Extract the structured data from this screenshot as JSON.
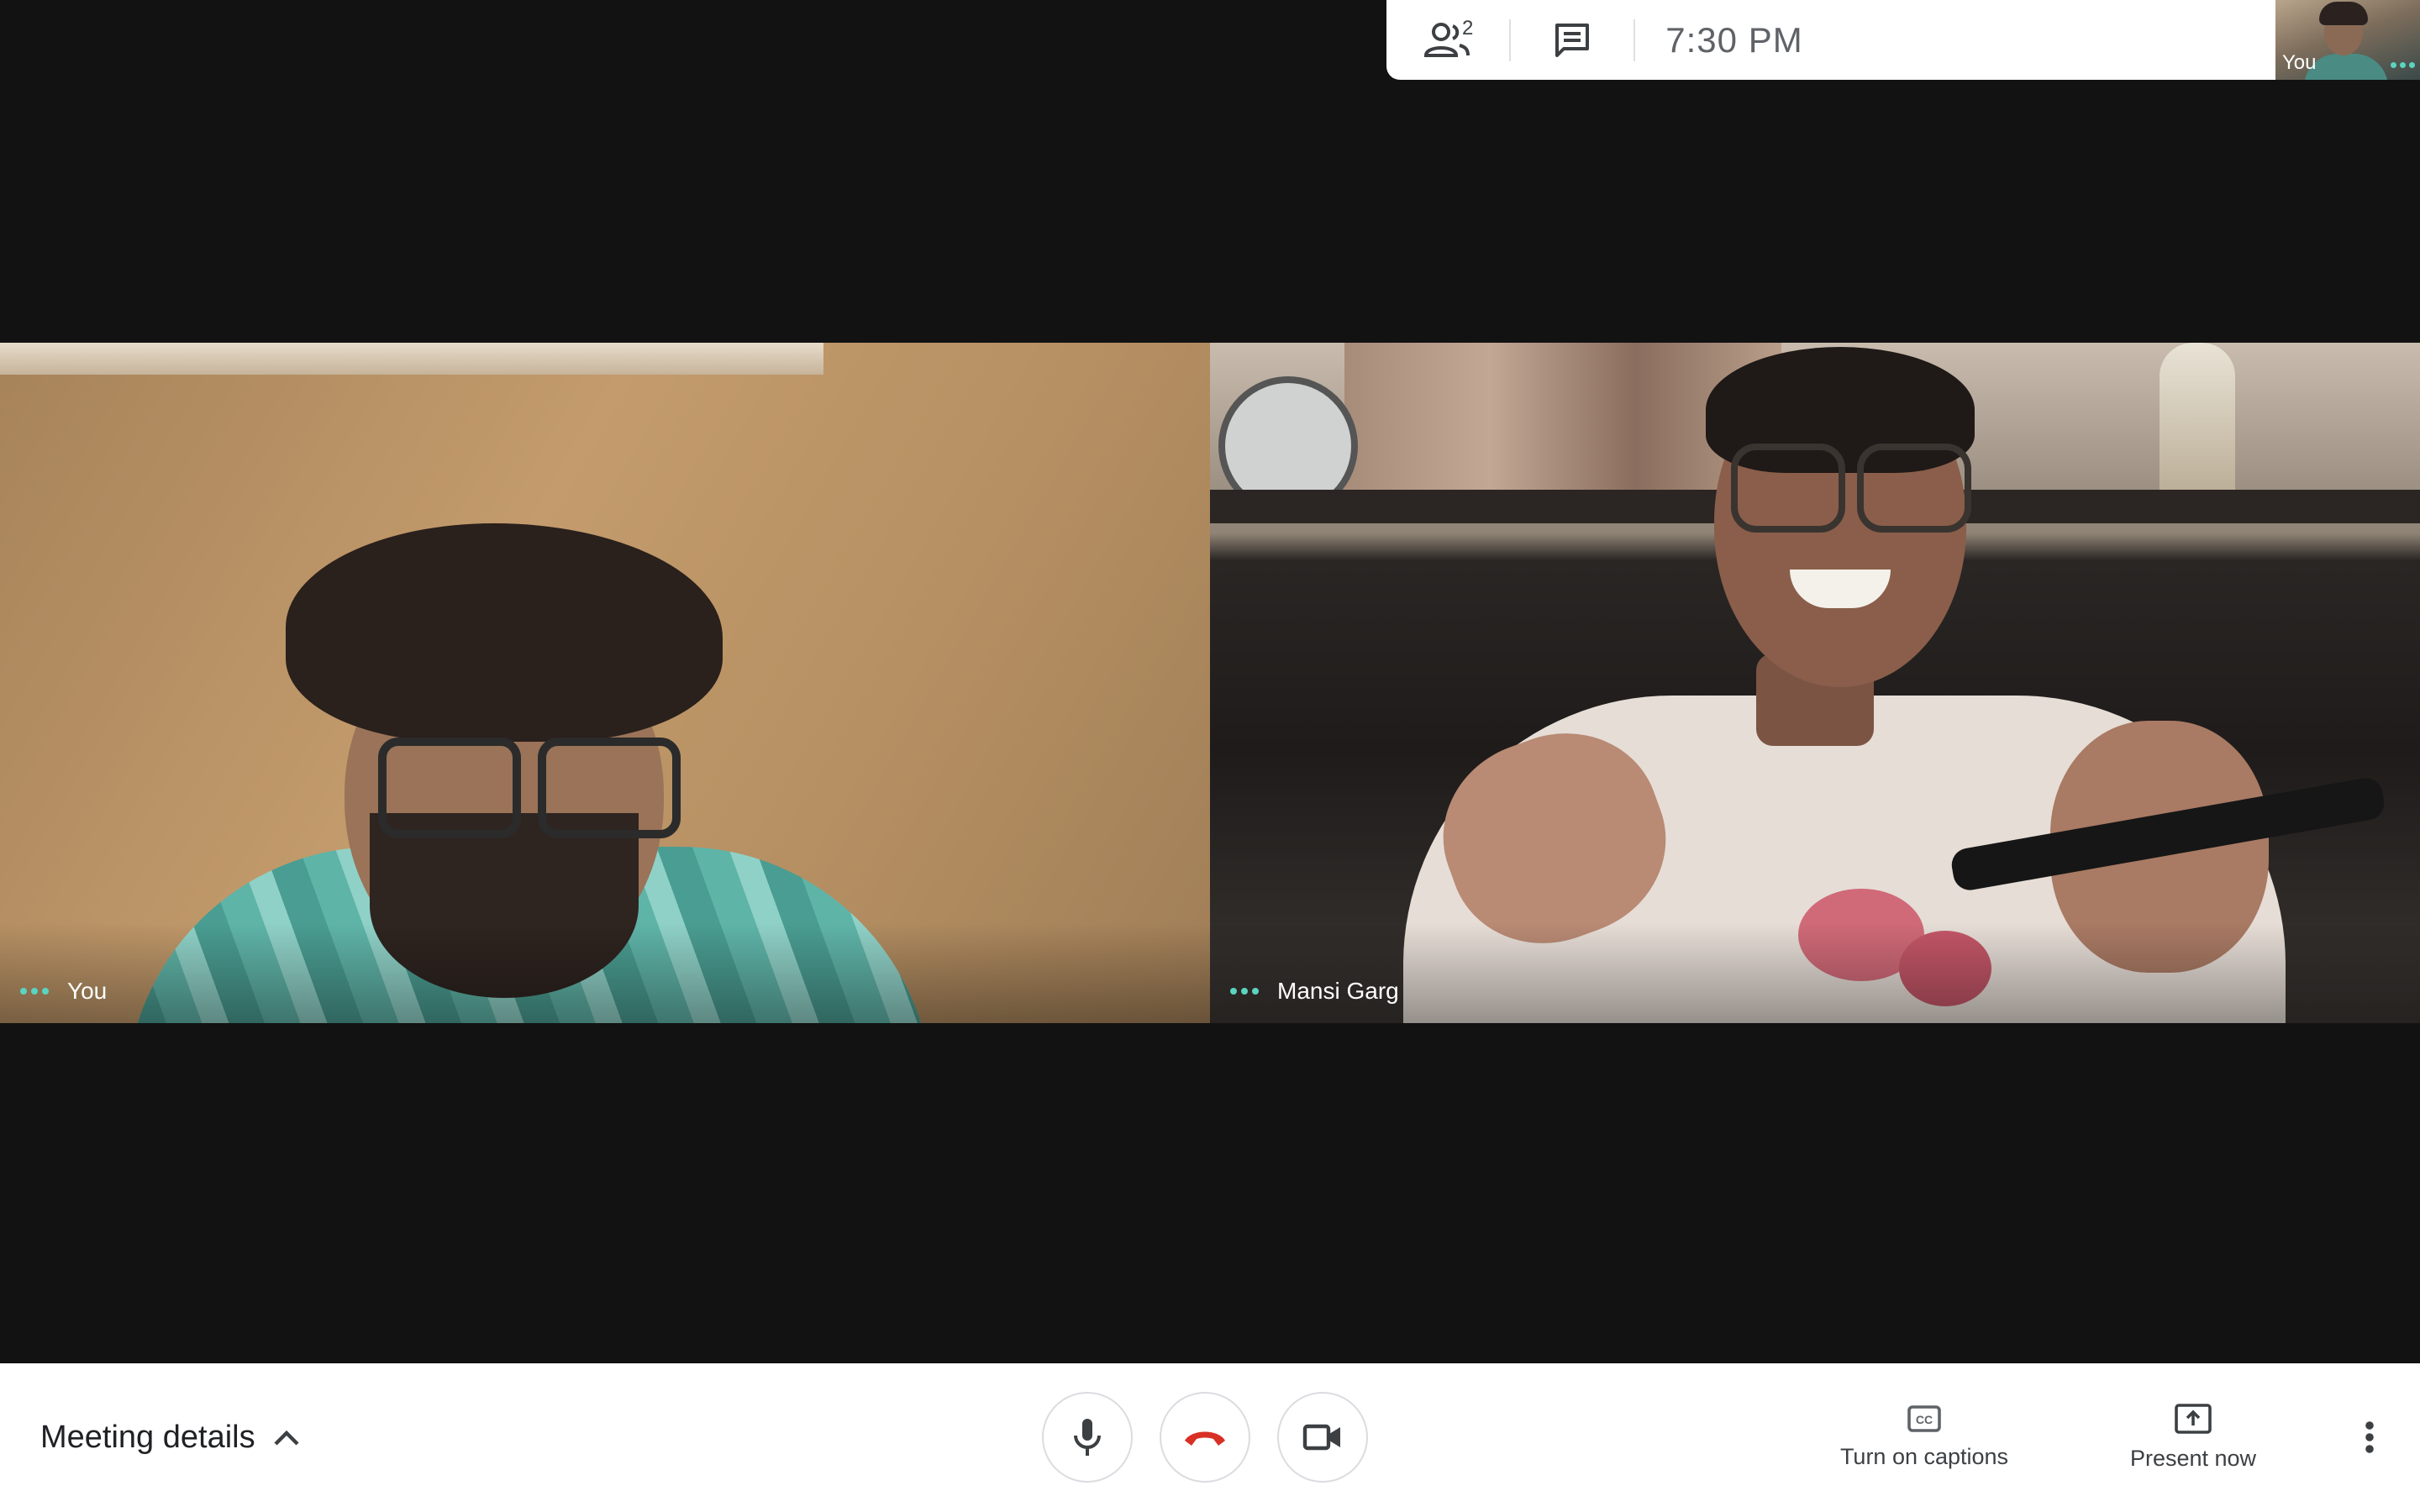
{
  "top_bar": {
    "participants_count": "2",
    "time": "7:30 PM",
    "self_thumbnail_label": "You",
    "icons": [
      "people-icon",
      "chat-icon",
      "more-dots-icon"
    ]
  },
  "tiles": [
    {
      "label": "You"
    },
    {
      "label": "Mansi Garg"
    }
  ],
  "bottom_bar": {
    "meeting_details_label": "Meeting details",
    "captions_label": "Turn on captions",
    "present_label": "Present now",
    "icons": [
      "chevron-up-icon",
      "microphone-icon",
      "hang-up-icon",
      "camera-icon",
      "captions-icon",
      "present-icon",
      "more-vert-icon"
    ]
  },
  "colors": {
    "stage_bg": "#121212",
    "hangup_red": "#d93025",
    "speaking_dots": "#5bd4c0",
    "bar_bg": "#ffffff"
  }
}
